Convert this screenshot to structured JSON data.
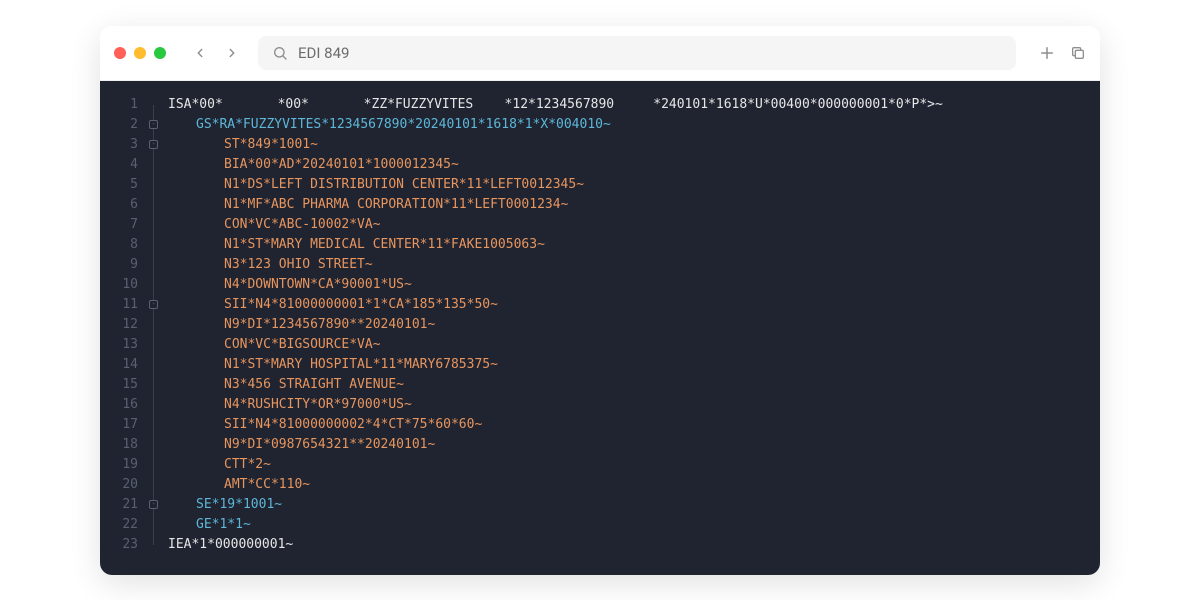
{
  "titlebar": {
    "search_value": "EDI 849"
  },
  "editor": {
    "lines": [
      {
        "n": 1,
        "color": "white",
        "indent": 0,
        "text": "ISA*00*       *00*       *ZZ*FUZZYVITES    *12*1234567890     *240101*1618*U*00400*000000001*0*P*>~"
      },
      {
        "n": 2,
        "color": "blue",
        "indent": 1,
        "text": "GS*RA*FUZZYVITES*1234567890*20240101*1618*1*X*004010~"
      },
      {
        "n": 3,
        "color": "orange",
        "indent": 2,
        "text": "ST*849*1001~"
      },
      {
        "n": 4,
        "color": "orange",
        "indent": 2,
        "text": "BIA*00*AD*20240101*1000012345~"
      },
      {
        "n": 5,
        "color": "orange",
        "indent": 2,
        "text": "N1*DS*LEFT DISTRIBUTION CENTER*11*LEFT0012345~"
      },
      {
        "n": 6,
        "color": "orange",
        "indent": 2,
        "text": "N1*MF*ABC PHARMA CORPORATION*11*LEFT0001234~"
      },
      {
        "n": 7,
        "color": "orange",
        "indent": 2,
        "text": "CON*VC*ABC-10002*VA~"
      },
      {
        "n": 8,
        "color": "orange",
        "indent": 2,
        "text": "N1*ST*MARY MEDICAL CENTER*11*FAKE1005063~"
      },
      {
        "n": 9,
        "color": "orange",
        "indent": 2,
        "text": "N3*123 OHIO STREET~"
      },
      {
        "n": 10,
        "color": "orange",
        "indent": 2,
        "text": "N4*DOWNTOWN*CA*90001*US~"
      },
      {
        "n": 11,
        "color": "orange",
        "indent": 2,
        "text": "SII*N4*81000000001*1*CA*185*135*50~"
      },
      {
        "n": 12,
        "color": "orange",
        "indent": 2,
        "text": "N9*DI*1234567890**20240101~"
      },
      {
        "n": 13,
        "color": "orange",
        "indent": 2,
        "text": "CON*VC*BIGSOURCE*VA~"
      },
      {
        "n": 14,
        "color": "orange",
        "indent": 2,
        "text": "N1*ST*MARY HOSPITAL*11*MARY6785375~"
      },
      {
        "n": 15,
        "color": "orange",
        "indent": 2,
        "text": "N3*456 STRAIGHT AVENUE~"
      },
      {
        "n": 16,
        "color": "orange",
        "indent": 2,
        "text": "N4*RUSHCITY*OR*97000*US~"
      },
      {
        "n": 17,
        "color": "orange",
        "indent": 2,
        "text": "SII*N4*81000000002*4*CT*75*60*60~"
      },
      {
        "n": 18,
        "color": "orange",
        "indent": 2,
        "text": "N9*DI*0987654321**20240101~"
      },
      {
        "n": 19,
        "color": "orange",
        "indent": 2,
        "text": "CTT*2~"
      },
      {
        "n": 20,
        "color": "orange",
        "indent": 2,
        "text": "AMT*CC*110~"
      },
      {
        "n": 21,
        "color": "blue",
        "indent": 1,
        "text": "SE*19*1001~"
      },
      {
        "n": 22,
        "color": "blue",
        "indent": 1,
        "text": "GE*1*1~"
      },
      {
        "n": 23,
        "color": "white",
        "indent": 0,
        "text": "IEA*1*000000001~"
      }
    ]
  }
}
